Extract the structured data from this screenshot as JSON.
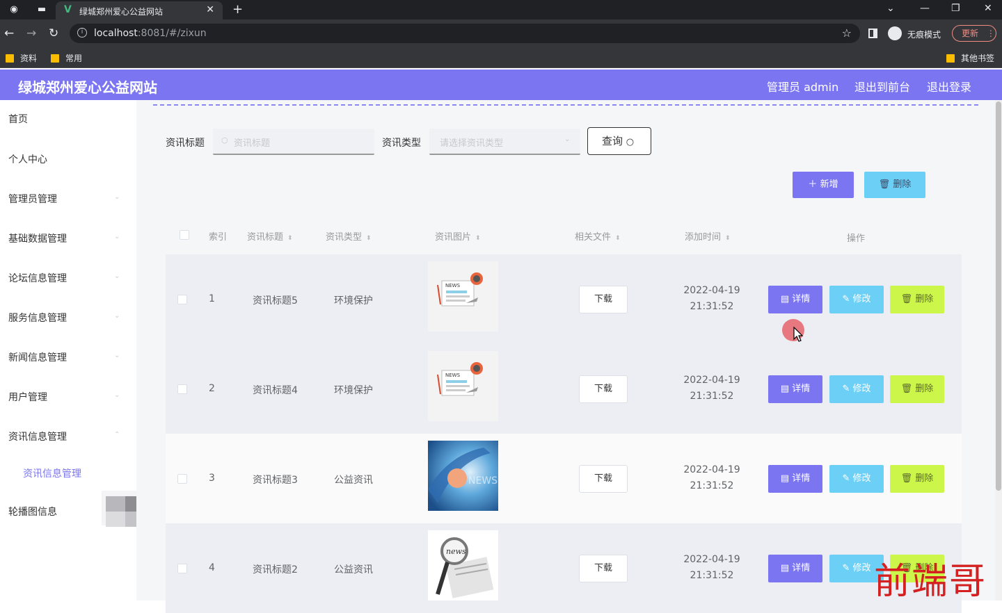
{
  "browser": {
    "tab_title": "绿城郑州爱心公益网站",
    "url_host": "localhost",
    "url_path": ":8081/#/zixun",
    "incognito_label": "无痕模式",
    "update_label": "更新",
    "bookmarks": [
      "资料",
      "常用"
    ],
    "other_bookmarks": "其他书签"
  },
  "header": {
    "site_title": "绿城郑州爱心公益网站",
    "admin_label": "管理员 admin",
    "to_front": "退出到前台",
    "logout": "退出登录"
  },
  "sidebar": {
    "items": [
      "首页",
      "个人中心",
      "管理员管理",
      "基础数据管理",
      "论坛信息管理",
      "服务信息管理",
      "新闻信息管理",
      "用户管理",
      "资讯信息管理",
      "轮播图信息"
    ],
    "active_sub": "资讯信息管理"
  },
  "filters": {
    "title_label": "资讯标题",
    "title_placeholder": "资讯标题",
    "type_label": "资讯类型",
    "type_placeholder": "请选择资讯类型",
    "search_label": "查询"
  },
  "actions": {
    "add_label": "新增",
    "delete_label": "删除"
  },
  "table": {
    "columns": [
      "索引",
      "资讯标题",
      "资讯类型",
      "资讯图片",
      "相关文件",
      "添加时间",
      "操作"
    ],
    "download_label": "下载",
    "detail_label": "详情",
    "edit_label": "修改",
    "delete_label": "删除",
    "rows": [
      {
        "index": "1",
        "title": "资讯标题5",
        "type": "环境保护",
        "image": "news-icon-image",
        "date": "2022-04-19",
        "time": "21:31:52"
      },
      {
        "index": "2",
        "title": "资讯标题4",
        "type": "环境保护",
        "image": "news-icon-image",
        "date": "2022-04-19",
        "time": "21:31:52"
      },
      {
        "index": "3",
        "title": "资讯标题3",
        "type": "公益资讯",
        "image": "news-globe-image",
        "date": "2022-04-19",
        "time": "21:31:52"
      },
      {
        "index": "4",
        "title": "资讯标题2",
        "type": "公益资讯",
        "image": "news-magnifier-image",
        "date": "2022-04-19",
        "time": "21:31:52"
      }
    ]
  },
  "watermark": "前端哥",
  "colors": {
    "accent": "#7b75f2",
    "edit": "#6ccff6",
    "delete": "#ccf64a"
  }
}
